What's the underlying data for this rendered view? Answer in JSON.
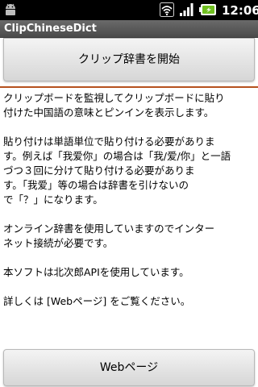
{
  "status_bar": {
    "time": "12:06",
    "icons": [
      "android-icon",
      "wifi-icon",
      "signal-icon",
      "battery-icon"
    ]
  },
  "app": {
    "title": "ClipChineseDict"
  },
  "buttons": {
    "start_clip_dictionary": "クリップ辞書を開始",
    "web_page": "Webページ"
  },
  "description": {
    "paragraph_1": "クリップボードを監視してクリップボードに貼り\n付けた中国語の意味とピンインを表示します。",
    "paragraph_2": "貼り付けは単語単位で貼り付ける必要がありま\nす。例えば「我爱你」の場合は「我/爱/你」と一語\nづつ３回に分けて貼り付ける必要がありま\nす。「我爱」等の場合は辞書を引けないの\nで「？」になります。",
    "paragraph_3": "オンライン辞書を使用していますのでインター\nネット接続が必要です。",
    "paragraph_4": "本ソフトは北次郎APIを使用しています。",
    "paragraph_5": "詳しくは [Webページ] をご覧ください。"
  },
  "colors": {
    "status_bar_bg": "#000000",
    "title_bar_bg": "#5a5a5a",
    "divider": "#b5511e",
    "battery_accent": "#6fbf1f"
  }
}
